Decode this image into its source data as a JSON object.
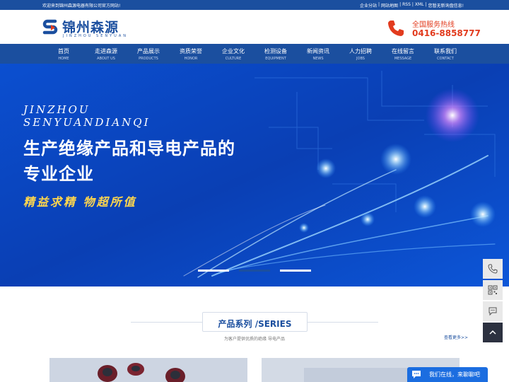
{
  "topbar": {
    "welcome": "欢迎来到锦州森源电器有限公司官方网站!",
    "links": [
      "企业分站",
      "|",
      "网站地图",
      "|",
      "RSS",
      "|",
      "XML",
      "|",
      "您暂无新询盘信息!"
    ]
  },
  "logo": {
    "cn": "锦州森源",
    "en": "JINZHOU SENYUAN"
  },
  "hotline": {
    "title": "全国服务热线",
    "number": "0416-8858777"
  },
  "nav": [
    {
      "cn": "首页",
      "en": "HOME"
    },
    {
      "cn": "走进森源",
      "en": "ABOUT US"
    },
    {
      "cn": "产品展示",
      "en": "PRODUCTS"
    },
    {
      "cn": "资质荣誉",
      "en": "HONOR"
    },
    {
      "cn": "企业文化",
      "en": "CULTURE"
    },
    {
      "cn": "检测设备",
      "en": "EQUIPMENT"
    },
    {
      "cn": "新闻资讯",
      "en": "NEWS"
    },
    {
      "cn": "人力招聘",
      "en": "JOBS"
    },
    {
      "cn": "在线留言",
      "en": "MESSAGE"
    },
    {
      "cn": "联系我们",
      "en": "CONTACT"
    }
  ],
  "banner": {
    "en_line1": "JINZHOU",
    "en_line2": "SENYUANDIANQI",
    "headline1": "生产绝缘产品和导电产品的",
    "headline2": "专业企业",
    "slogan": "精益求精  物超所值",
    "active_slide": 2
  },
  "section": {
    "title": "产品系列 /SERIES",
    "subtitle": "为客户提供优质的绝缘 导电产品",
    "more": "查看更多>>"
  },
  "sidebar": [
    "phone-icon",
    "qrcode-icon",
    "chat-bubble-icon",
    "back-to-top-icon"
  ],
  "chat": {
    "label": "我们在线，来聊聊吧"
  },
  "colors": {
    "brand": "#1b4f9f",
    "accent": "#e23b1e",
    "slogan": "#ffd64d",
    "chat": "#1b6de0"
  }
}
